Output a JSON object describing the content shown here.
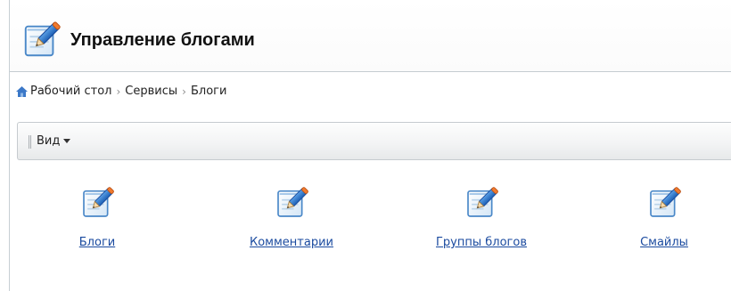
{
  "page": {
    "title": "Управление блогами"
  },
  "breadcrumb": {
    "items": [
      "Рабочий стол",
      "Сервисы",
      "Блоги"
    ],
    "separator": "›"
  },
  "toolbar": {
    "view_label": "Вид"
  },
  "tiles": [
    {
      "label": "Блоги",
      "icon": "notepad-pencil-icon"
    },
    {
      "label": "Комментарии",
      "icon": "notepad-pencil-icon"
    },
    {
      "label": "Группы блогов",
      "icon": "notepad-pencil-icon"
    },
    {
      "label": "Смайлы",
      "icon": "notepad-pencil-icon"
    }
  ],
  "colors": {
    "link": "#1a4a9f",
    "home_icon": "#3b78c8"
  }
}
